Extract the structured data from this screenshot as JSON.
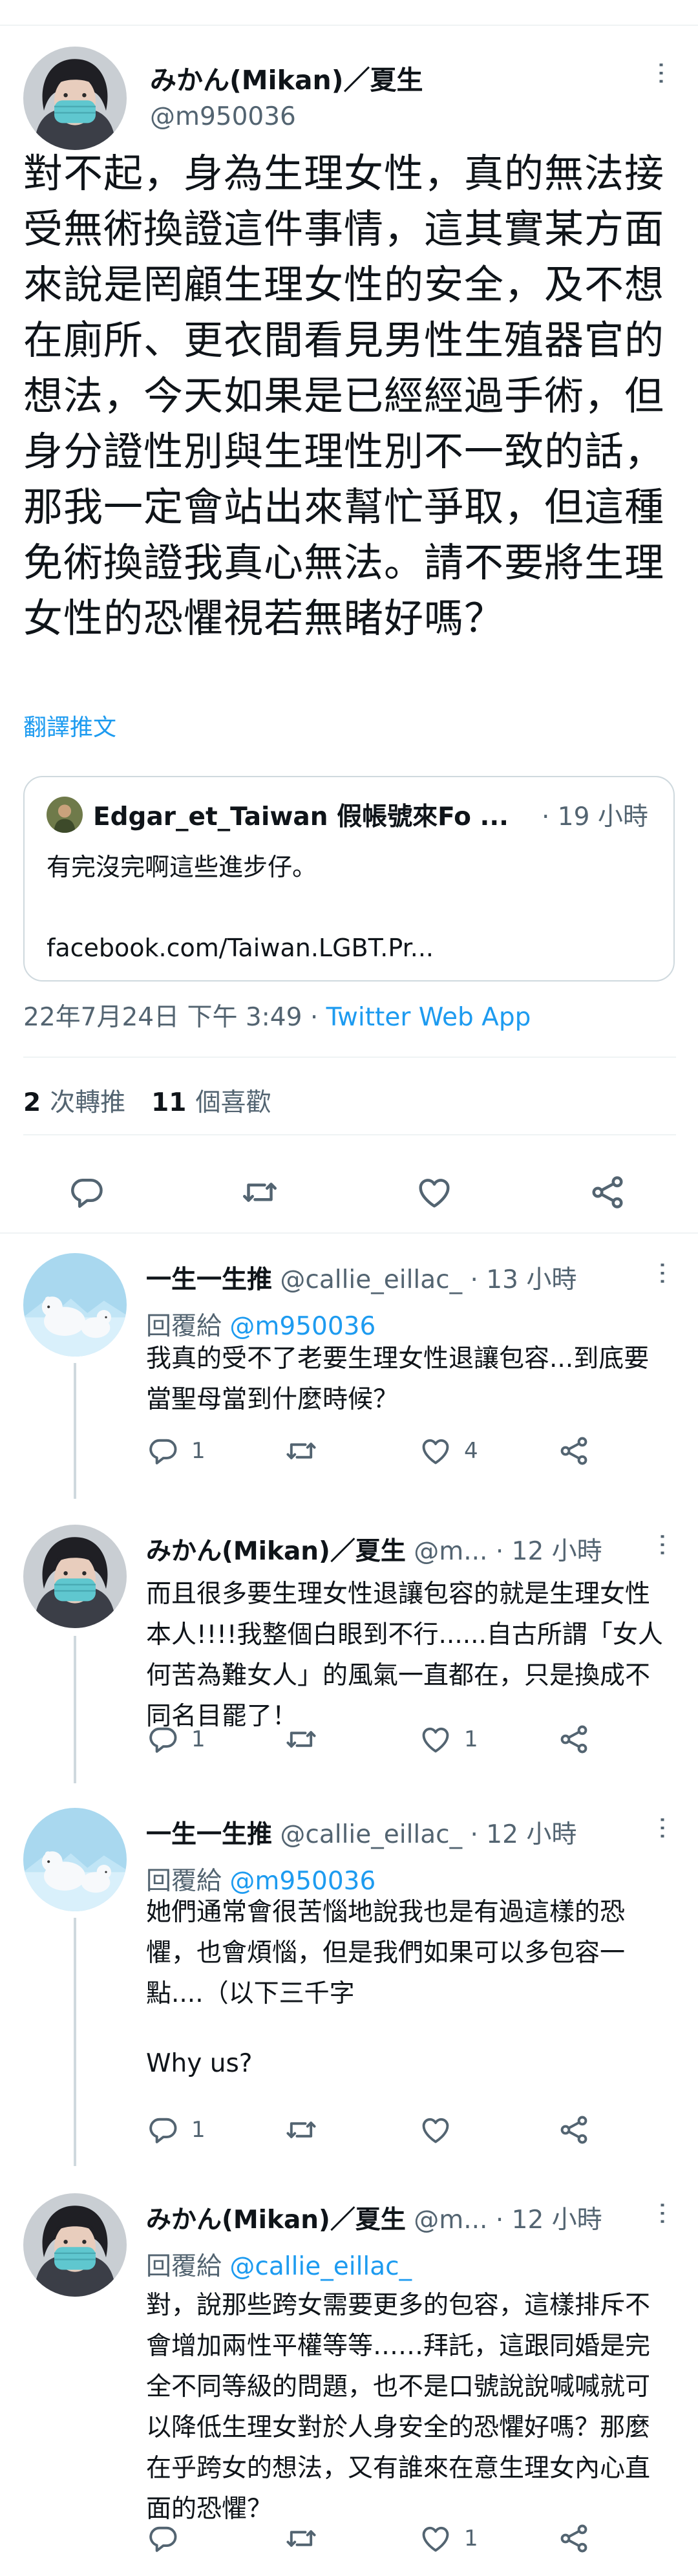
{
  "main_tweet": {
    "author_name": "みかん(Mikan)／夏生",
    "author_handle": "@m950036",
    "text": "對不起，身為生理女性，真的無法接受無術換證這件事情，這其實某方面來說是罔顧生理女性的安全，及不想在廁所、更衣間看見男性生殖器官的想法，今天如果是已經經過手術，但身分證性別與生理性別不一致的話，那我一定會站出來幫忙爭取，但這種免術換證我真心無法。請不要將生理女性的恐懼視若無睹好嗎？",
    "translate_label": "翻譯推文",
    "quote": {
      "author": "Edgar_et_Taiwan 假帳號來Fo ...",
      "time": "· 19 小時",
      "text": "有完沒完啊這些進步仔。",
      "link": "facebook.com/Taiwan.LGBT.Pr..."
    },
    "timestamp": "22年7月24日 下午 3:49 · ",
    "source": "Twitter Web App",
    "retweets_count": "2",
    "retweets_label": "次轉推",
    "likes_count": "11",
    "likes_label": "個喜歡",
    "more_label": "···"
  },
  "replies": [
    {
      "author_name": "一生一生推",
      "author_handle": "@callie_eillac_",
      "time": "· 13 小時",
      "replying_label": "回覆給 ",
      "replying_to": "@m950036",
      "text": "我真的受不了老要生理女性退讓包容...到底要當聖母當到什麼時候？",
      "extra_text": "",
      "reply_count": "1",
      "retweet_count": "",
      "like_count": "4"
    },
    {
      "author_name": "みかん(Mikan)／夏生",
      "author_handle": "@m...",
      "time": "· 12 小時",
      "replying_label": "",
      "replying_to": "",
      "text": "而且很多要生理女性退讓包容的就是生理女性本人!!!!我整個白眼到不行......自古所謂「女人何苦為難女人」的風氣一直都在，只是換成不同名目罷了！",
      "extra_text": "",
      "reply_count": "1",
      "retweet_count": "",
      "like_count": "1"
    },
    {
      "author_name": "一生一生推",
      "author_handle": "@callie_eillac_",
      "time": "· 12 小時",
      "replying_label": "回覆給 ",
      "replying_to": "@m950036",
      "text": "她們通常會很苦惱地說我也是有過這樣的恐懼，也會煩惱，但是我們如果可以多包容一點....（以下三千字",
      "extra_text": "Why us?",
      "reply_count": "1",
      "retweet_count": "",
      "like_count": ""
    },
    {
      "author_name": "みかん(Mikan)／夏生",
      "author_handle": "@m...",
      "time": "· 12 小時",
      "replying_label": "回覆給 ",
      "replying_to": "@callie_eillac_",
      "text": "對，說那些跨女需要更多的包容，這樣排斥不會增加兩性平權等等……拜託，這跟同婚是完全不同等級的問題，也不是口號說說喊喊就可以降低生理女對於人身安全的恐懼好嗎？那麼在乎跨女的想法，又有誰來在意生理女內心直面的恐懼？",
      "extra_text": "",
      "reply_count": "",
      "retweet_count": "",
      "like_count": "1"
    }
  ],
  "icons": {
    "reply": "reply-icon",
    "retweet": "retweet-icon",
    "like": "like-icon",
    "share": "share-icon",
    "more": "more-icon"
  },
  "colors": {
    "link": "#1d9bf0",
    "muted": "#536471",
    "text": "#0f1419",
    "border": "#cfd9de"
  }
}
